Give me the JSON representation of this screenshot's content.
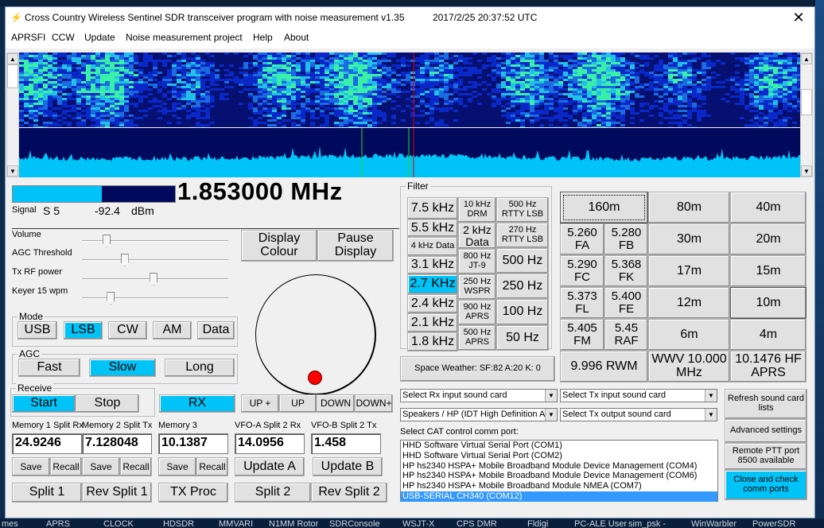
{
  "window": {
    "title": "Cross Country Wireless Sentinel SDR transceiver program with noise measurement v1.35",
    "timestamp": "2017/2/25 20:37:52 UTC",
    "close_glyph": "✕"
  },
  "menu": [
    "APRSFI",
    "CCW",
    "Update",
    "Noise measurement project",
    "Help",
    "About"
  ],
  "display": {
    "waterfall_colors": [
      "#061070",
      "#0a28c8",
      "#1a6ae0",
      "#22c0e8",
      "#3af0a8"
    ],
    "spectrum_fill": "#00c4f8",
    "spectrum_bg": "#000a5c",
    "scroll_up": "▲",
    "scroll_down": "▼"
  },
  "signal": {
    "label": "Signal",
    "s_meter": "S 5",
    "dbm_value": "-92.4",
    "dbm_unit": "dBm",
    "level_fraction": 0.55
  },
  "frequency": "1.853000 MHz",
  "sliders": [
    {
      "label": "Volume",
      "value": 0.15
    },
    {
      "label": "AGC Threshold",
      "value": 0.28
    },
    {
      "label": "Tx RF power",
      "value": 0.49
    },
    {
      "label": "Keyer 15 wpm",
      "value": 0.18
    }
  ],
  "display_buttons": {
    "colour": "Display Colour",
    "pause": "Pause Display"
  },
  "mode": {
    "label": "Mode",
    "options": [
      "USB",
      "LSB",
      "CW",
      "AM",
      "Data"
    ],
    "selected": "LSB"
  },
  "agc": {
    "label": "AGC",
    "options": [
      "Fast",
      "Slow",
      "Long"
    ],
    "selected": "Slow"
  },
  "receive": {
    "label": "Receive",
    "start": "Start",
    "stop": "Stop",
    "rx": "RX"
  },
  "tuning": [
    "UP +",
    "UP",
    "DOWN",
    "DOWN+"
  ],
  "memories": {
    "m1_label": "Memory 1 Split Rx",
    "m2_label": "Memory 2 Split Tx",
    "m3_label": "Memory 3",
    "vfoa_label": "VFO-A Split 2 Rx",
    "vfob_label": "VFO-B Split 2 Tx",
    "m1": "24.9246",
    "m2": "7.128048",
    "m3": "10.1387",
    "vfoa": "14.0956",
    "vfob": "1.458",
    "save": "Save",
    "recall": "Recall",
    "update_a": "Update A",
    "update_b": "Update B"
  },
  "split_buttons": [
    "Split 1",
    "Rev Split 1",
    "TX Proc",
    "Split 2",
    "Rev Split 2"
  ],
  "filter": {
    "label": "Filter",
    "col1": [
      "7.5 kHz",
      "5.5 kHz",
      "4 kHz Data",
      "3.1 kHz",
      "2.7 KHz",
      "2.4 kHz",
      "2.1 kHz",
      "1.8 kHz"
    ],
    "col2": [
      "10 kHz DRM",
      "2 kHz Data",
      "800 Hz JT-9",
      "250 Hz WSPR",
      "900 Hz APRS",
      "500 Hz APRS"
    ],
    "col3": [
      "500 Hz RTTY LSB",
      "270 Hz RTTY LSB",
      "500 Hz",
      "250 Hz",
      "100 Hz",
      "50 Hz"
    ],
    "selected": "2.7 KHz"
  },
  "bands": {
    "b160": "160m",
    "b80": "80m",
    "b40": "40m",
    "b30": "30m",
    "b20": "20m",
    "b17": "17m",
    "b15": "15m",
    "b12": "12m",
    "b10": "10m",
    "b6": "6m",
    "b4": "4m",
    "fa": "5.260 FA",
    "fb": "5.280 FB",
    "fc": "5.290 FC",
    "fk": "5.368 FK",
    "fl": "5.373 FL",
    "fe": "5.400 FE",
    "fm": "5.405 FM",
    "raf": "5.45 RAF",
    "rwm": "9.996 RWM",
    "wwv": "WWV 10.000 MHz",
    "aprs": "10.1476 HF APRS"
  },
  "space_weather": "Space Weather: SF:82  A:20  K: 0",
  "sound": {
    "rx_input": "Select Rx input sound card",
    "tx_input": "Select Tx input sound card",
    "rx_output": "Speakers / HP (IDT High Definition A",
    "tx_output": "Select Tx output sound card"
  },
  "cat": {
    "label": "Select CAT control  comm port:",
    "ports": [
      "HHD Software Virtual Serial Port (COM1)",
      "HHD Software Virtual Serial Port (COM2)",
      "HP hs2340 HSPA+ Mobile Broadband Module Device Management (COM4)",
      "HP hs2340 HSPA+ Mobile Broadband Module Device Management (COM6)",
      "HP hs2340 HSPA+ Mobile Broadband Module NMEA (COM7)",
      "USB-SERIAL CH340 (COM12)"
    ],
    "selected_index": 5
  },
  "side_buttons": {
    "refresh": "Refresh sound card lists",
    "advanced": "Advanced settings",
    "remote_ptt": "Remote PTT port 8500 available",
    "close_check": "Close and check comm ports"
  },
  "taskbar": [
    "mes",
    "APRS",
    "CLOCK",
    "HDSDR",
    "MMVARI",
    "N1MM Rotor",
    "SDRConsole",
    "WSJT-X",
    "CPS DMR",
    "Fldigi",
    "PC-ALE User",
    "sim_psk -",
    "WinWarbler",
    "PowerSDR"
  ]
}
